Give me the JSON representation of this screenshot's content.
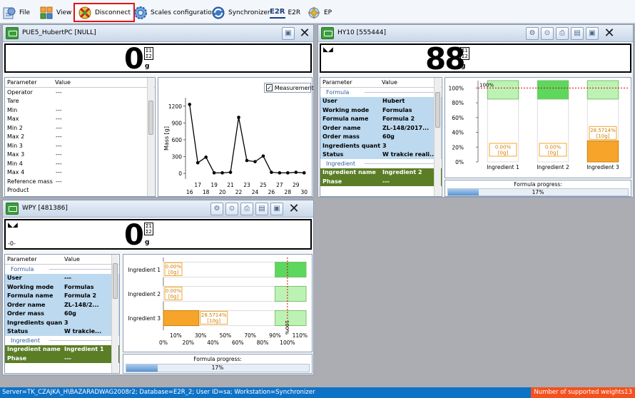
{
  "toolbar": {
    "file": "File",
    "view": "View",
    "disconnect": "Disconnect",
    "scales_config": "Scales configuration",
    "synchronizer": "Synchronizer",
    "e2r_badge": "E2R",
    "e2r": "E2R",
    "ep": "EP"
  },
  "panel1": {
    "title": "PUE5_HubertPC [NULL]",
    "value": "0",
    "unit": "g",
    "table_header": [
      "Parameter",
      "Value"
    ],
    "rows": [
      [
        "Operator",
        "---"
      ],
      [
        "Tare",
        ""
      ],
      [
        "Min",
        "---"
      ],
      [
        "Max",
        "---"
      ],
      [
        "Min 2",
        "---"
      ],
      [
        "Max 2",
        "---"
      ],
      [
        "Min 3",
        "---"
      ],
      [
        "Max 3",
        "---"
      ],
      [
        "Min 4",
        "---"
      ],
      [
        "Max 4",
        "---"
      ],
      [
        "Reference mass",
        "---"
      ],
      [
        "Product",
        ""
      ]
    ],
    "measurement_label": "Measurement"
  },
  "panel2": {
    "title": "HY10 [555444]",
    "value": "88",
    "unit": "g",
    "table_header": [
      "Parameter",
      "Value"
    ],
    "section_formula": "Formula",
    "rows": [
      [
        "User",
        "Hubert"
      ],
      [
        "Working mode",
        "Formulas"
      ],
      [
        "Formula name",
        "Formula 2"
      ],
      [
        "Order name",
        "ZL-148/2017..."
      ],
      [
        "Order mass",
        "60g"
      ],
      [
        "Ingredients quantity",
        "3"
      ],
      [
        "Status",
        "W trakcie reali..."
      ]
    ],
    "section_ingredient": "Ingredient",
    "ingredient_row": [
      "Ingredient name",
      "Ingredient 2"
    ],
    "phase_row": [
      "Phase",
      "---"
    ],
    "progress_label": "Formula progress:",
    "progress_text": "17%",
    "progress_value": 0.17
  },
  "panel3": {
    "title": "WPY [481386]",
    "value": "0",
    "unit": "g",
    "zero_mark": "-0-",
    "table_header": [
      "Parameter",
      "Value"
    ],
    "section_formula": "Formula",
    "rows": [
      [
        "User",
        "---"
      ],
      [
        "Working mode",
        "Formulas"
      ],
      [
        "Formula name",
        "Formula 2"
      ],
      [
        "Order name",
        "ZL-148/2..."
      ],
      [
        "Order mass",
        "60g"
      ],
      [
        "Ingredients quantity",
        "3"
      ],
      [
        "Status",
        "W trakcie..."
      ]
    ],
    "section_ingredient": "Ingredient",
    "ingredient_row": [
      "Ingredient name",
      "Ingredient 1"
    ],
    "phase_row": [
      "Phase",
      "---"
    ],
    "progress_label": "Formula progress:",
    "progress_text": "17%",
    "progress_value": 0.17
  },
  "status": {
    "text": "Server=TK_CZAJKA_H\\BAZARADWAG2008r2; Database=E2R_2; User ID=sa; Workstation=Synchronizer",
    "supported": "Number of supported weights13"
  },
  "colors": {
    "accent_red": "#e0131b",
    "bar_orange": "#f7a52a",
    "bar_green": "#3fc33f",
    "status_blue": "#0e72c7"
  },
  "chart_data": [
    {
      "type": "line",
      "title": "",
      "xlabel": "",
      "ylabel": "Mass [g]",
      "x": [
        16,
        17,
        18,
        19,
        20,
        21,
        22,
        23,
        24,
        25,
        26,
        27,
        28,
        29,
        30
      ],
      "y": [
        1230,
        190,
        290,
        10,
        10,
        20,
        1000,
        230,
        210,
        310,
        20,
        10,
        10,
        20,
        10
      ],
      "xlim": [
        15.5,
        30.5
      ],
      "ylim": [
        -100,
        1350
      ],
      "yticks": [
        0,
        300,
        600,
        900,
        1200
      ],
      "xticks_top": [
        17,
        19,
        21,
        23,
        25,
        27,
        29
      ],
      "xticks_bottom": [
        16,
        18,
        20,
        22,
        24,
        26,
        28,
        30
      ],
      "legend": "Measurement"
    },
    {
      "type": "bar",
      "categories": [
        "Ingredient 1",
        "Ingredient 2",
        "Ingredient 3"
      ],
      "values": [
        0,
        0,
        28.5714
      ],
      "labels": [
        "0.00%\n[0g]",
        "0.00%\n[0g]",
        "28.5714%\n[10g]"
      ],
      "target_line": 100,
      "target_label": "100%",
      "yticks": [
        "0%",
        "20%",
        "40%",
        "60%",
        "80%",
        "100%"
      ],
      "ylim": [
        0,
        110
      ]
    },
    {
      "type": "bar",
      "orientation": "horizontal",
      "categories": [
        "Ingredient 1",
        "Ingredient 2",
        "Ingredient 3"
      ],
      "values": [
        0,
        0,
        28.5714
      ],
      "labels": [
        "0.00%\n[0g]",
        "0.00%\n[0g]",
        "28.5714%\n[10g]"
      ],
      "target_line": 100,
      "target_label": "100%",
      "xticks_top": [
        "10%",
        "30%",
        "50%",
        "70%",
        "90%",
        "110%"
      ],
      "xticks_bottom": [
        "0%",
        "20%",
        "40%",
        "60%",
        "80%",
        "100%"
      ],
      "xlim": [
        0,
        115
      ]
    }
  ]
}
